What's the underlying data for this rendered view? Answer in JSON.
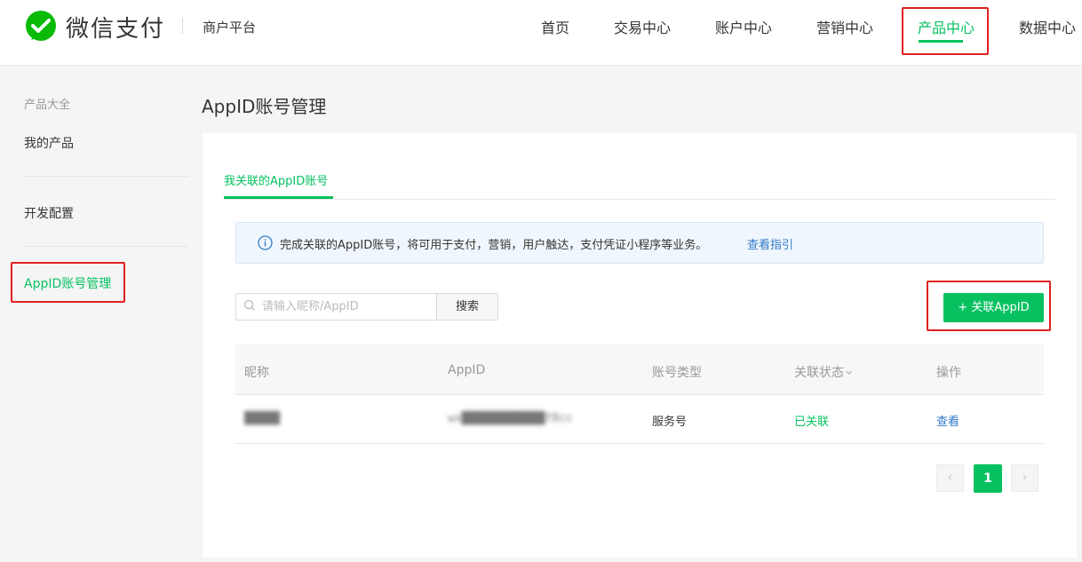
{
  "header": {
    "brand": "微信支付",
    "platform": "商户平台",
    "nav": [
      {
        "label": "首页"
      },
      {
        "label": "交易中心"
      },
      {
        "label": "账户中心"
      },
      {
        "label": "营销中心"
      },
      {
        "label": "产品中心"
      },
      {
        "label": "数据中心"
      }
    ],
    "active_nav": "产品中心"
  },
  "sidebar": {
    "category": "产品大全",
    "items": [
      {
        "label": "我的产品"
      },
      {
        "label": "开发配置"
      },
      {
        "label": "AppID账号管理"
      }
    ],
    "active_item": "AppID账号管理"
  },
  "main": {
    "page_title": "AppID账号管理",
    "tab": "我关联的AppID账号",
    "info": {
      "text": "完成关联的AppID账号，将可用于支付，营销，用户触达，支付凭证小程序等业务。",
      "link": "查看指引"
    },
    "search": {
      "placeholder": "请输入昵称/AppID",
      "button": "搜索"
    },
    "add_button": "+ 关联AppID",
    "table": {
      "columns": [
        "昵称",
        "AppID",
        "账号类型",
        "关联状态",
        "操作"
      ],
      "rows": [
        {
          "nickname": "████",
          "appid": "wx████████████f8cc",
          "type": "服务号",
          "status": "已关联",
          "action": "查看"
        }
      ]
    },
    "pagination": {
      "current": "1",
      "prev": "‹",
      "next": "›"
    }
  },
  "colors": {
    "accent": "#07c160",
    "link": "#2f7ac7",
    "highlight_box": "#e02020"
  }
}
